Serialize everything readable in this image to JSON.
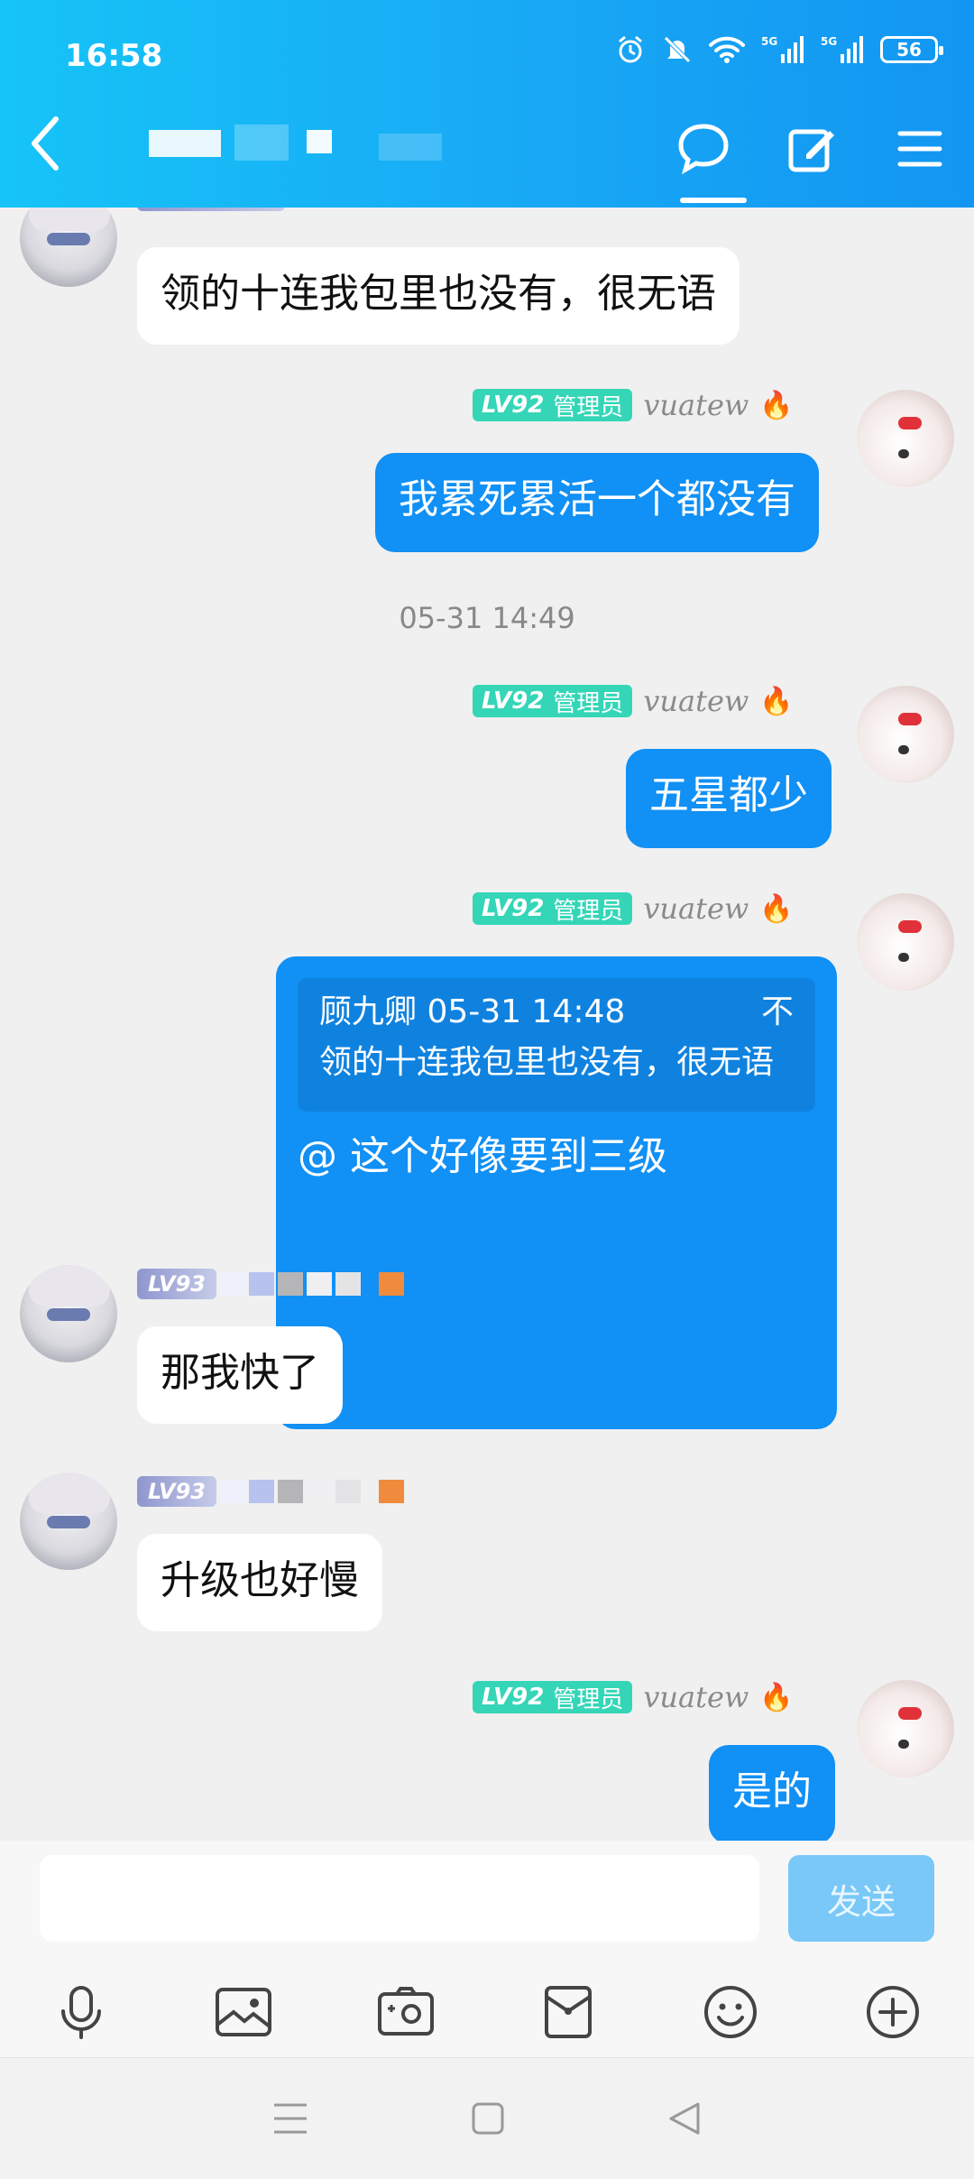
{
  "status_bar": {
    "time": "16:58",
    "battery": "56",
    "network_1": "5G",
    "network_2": "5G"
  },
  "header": {
    "title": ""
  },
  "messages": [
    {
      "side": "left",
      "text": "领的十连我包里也没有，很无语"
    },
    {
      "side": "right",
      "badge_level": "LV92",
      "badge_role": "管理员",
      "signature": "vuatew",
      "text": "我累死累活一个都没有"
    },
    {
      "type": "timestamp",
      "text": "05-31 14:49"
    },
    {
      "side": "right",
      "badge_level": "LV92",
      "badge_role": "管理员",
      "signature": "vuatew",
      "text": "五星都少"
    },
    {
      "side": "right",
      "badge_level": "LV92",
      "badge_role": "管理员",
      "signature": "vuatew",
      "quote": {
        "author": "顾九卿",
        "time": "05-31 14:48",
        "extra": "不",
        "text": "领的十连我包里也没有，很无语"
      },
      "text": "@ 这个好像要到三级"
    },
    {
      "side": "left",
      "badge_level": "LV93",
      "text": "那我快了"
    },
    {
      "side": "left",
      "badge_level": "LV93",
      "text": "升级也好慢"
    },
    {
      "side": "right",
      "badge_level": "LV92",
      "badge_role": "管理员",
      "signature": "vuatew",
      "text": "是的"
    }
  ],
  "input": {
    "placeholder": "",
    "send_label": "发送"
  },
  "toolbar": [
    "mic-icon",
    "image-icon",
    "camera-icon",
    "red-packet-icon",
    "emoji-icon",
    "plus-icon"
  ],
  "colors": {
    "header": "#18a8f5",
    "bubble_right": "#1190f5",
    "badge": "#34d6b7",
    "send_disabled": "#79c8f8"
  }
}
